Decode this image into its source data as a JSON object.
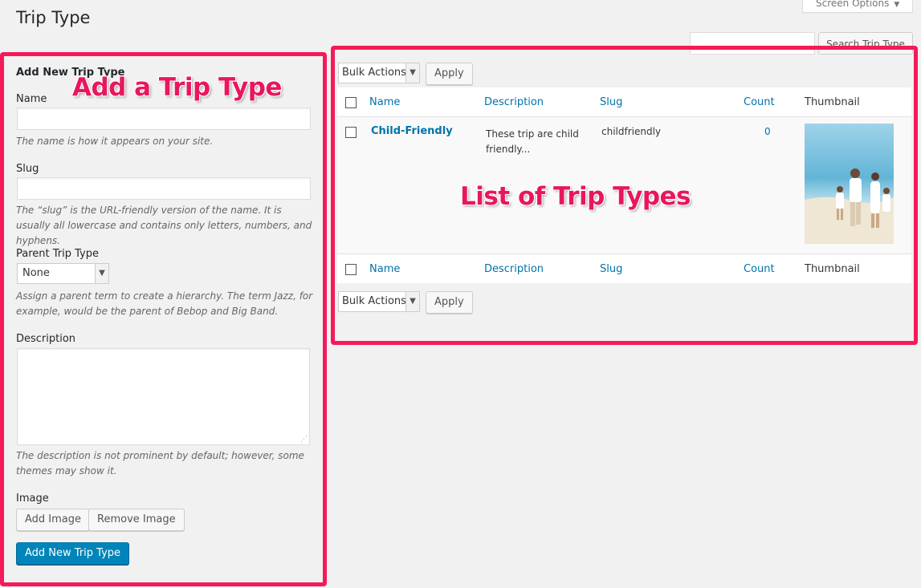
{
  "page": {
    "title": "Trip Type"
  },
  "header": {
    "screen_options": "Screen Options",
    "search_button": "Search Trip Type",
    "search_placeholder": ""
  },
  "form": {
    "heading": "Add New Trip Type",
    "name_label": "Name",
    "name_help": "The name is how it appears on your site.",
    "slug_label": "Slug",
    "slug_help": "The “slug” is the URL-friendly version of the name. It is usually all lowercase and contains only letters, numbers, and hyphens.",
    "parent_label": "Parent Trip Type",
    "parent_value": "None",
    "parent_help": "Assign a parent term to create a hierarchy. The term Jazz, for example, would be the parent of Bebop and Big Band.",
    "description_label": "Description",
    "description_help": "The description is not prominent by default; however, some themes may show it.",
    "image_label": "Image",
    "add_image": "Add Image",
    "remove_image": "Remove Image",
    "submit": "Add New Trip Type"
  },
  "list": {
    "bulk_actions": "Bulk Actions",
    "apply": "Apply",
    "columns": {
      "name": "Name",
      "description": "Description",
      "slug": "Slug",
      "count": "Count",
      "thumbnail": "Thumbnail"
    },
    "rows": [
      {
        "name": "Child-Friendly",
        "description": "These trip are child friendly...",
        "slug": "childfriendly",
        "count": "0",
        "thumbnail": "photo of family on beach"
      }
    ]
  },
  "annotations": {
    "form_callout": "Add a Trip Type",
    "list_callout": "List of Trip Types",
    "highlight_color": "#f51a59"
  }
}
